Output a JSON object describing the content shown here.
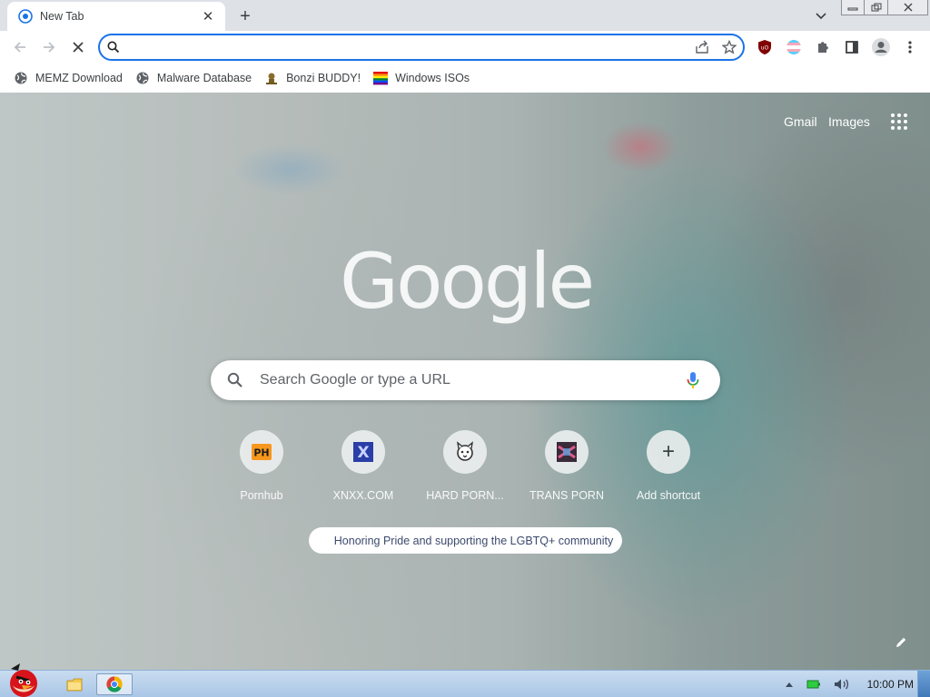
{
  "tab": {
    "title": "New Tab"
  },
  "omnibox": {
    "value": "",
    "placeholder": ""
  },
  "bookmarks": [
    {
      "label": "MEMZ Download",
      "icon": "globe-icon"
    },
    {
      "label": "Malware Database",
      "icon": "globe-icon"
    },
    {
      "label": "Bonzi BUDDY!",
      "icon": "bonzi-icon"
    },
    {
      "label": "Windows ISOs",
      "icon": "rainbow-flag-icon"
    }
  ],
  "ntp": {
    "gmail": "Gmail",
    "images": "Images",
    "logo": "Google",
    "search_placeholder": "Search Google or type a URL",
    "shortcuts": [
      {
        "label": "Pornhub",
        "icon_text": "PH"
      },
      {
        "label": "XNXX.COM",
        "icon_text": "X"
      },
      {
        "label": "HARD PORN...",
        "icon_text": ""
      },
      {
        "label": "TRANS PORN",
        "icon_text": ""
      },
      {
        "label": "Add shortcut",
        "icon_text": "+"
      }
    ],
    "doodle_chip": "Honoring Pride and supporting the LGBTQ+ community"
  },
  "taskbar": {
    "clock": "10:00 PM"
  },
  "colors": {
    "accent": "#1a73e8",
    "tabstrip": "#dee1e6",
    "taskbar": "#b8d0ea"
  }
}
